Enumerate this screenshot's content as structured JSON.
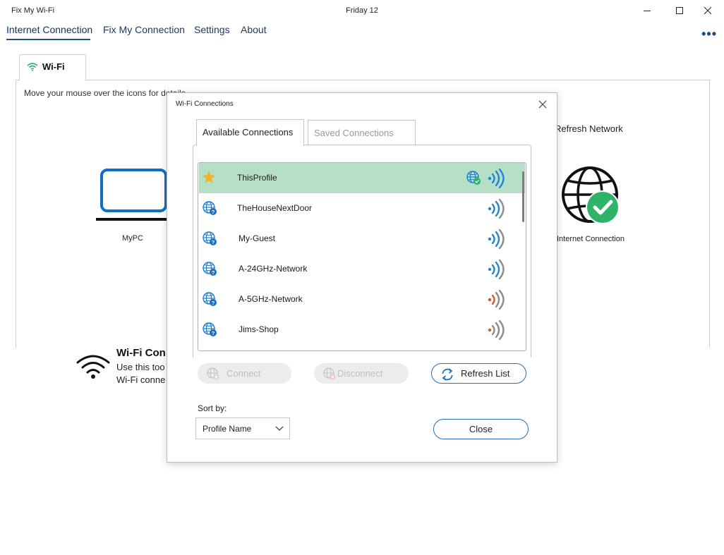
{
  "window": {
    "app_title": "Fix My Wi-Fi",
    "center_title": "Friday 12"
  },
  "nav": {
    "items": [
      "Internet Connection",
      "Fix My Connection",
      "Settings",
      "About"
    ],
    "active": "Internet Connection",
    "more": "•••"
  },
  "main": {
    "tab_label": "Wi-Fi",
    "hint": "Move your mouse over the icons for details",
    "mypc_label": "MyPC",
    "refresh_network_label": "Refresh Network",
    "internet_connection_label": "Internet Connection",
    "wifi_status_title": "Wi-Fi Con",
    "wifi_status_line1": "Use this too",
    "wifi_status_line2": "Wi-Fi conne"
  },
  "dialog": {
    "title": "Wi-Fi Connections",
    "tabs": [
      "Available Connections",
      "Saved Connections"
    ],
    "active_tab": "Available Connections",
    "networks": [
      {
        "name": "ThisProfile",
        "selected": true,
        "icon": "star-icon",
        "signal_color": "#1f86d6",
        "internet": true
      },
      {
        "name": "TheHouseNextDoor",
        "selected": false,
        "icon": "globe-question-icon",
        "signal_color": "#1f86d6",
        "internet": false
      },
      {
        "name": "My-Guest",
        "selected": false,
        "icon": "globe-question-icon",
        "signal_color": "#1f86d6",
        "internet": false
      },
      {
        "name": "A-24GHz-Network",
        "selected": false,
        "icon": "globe-question-icon",
        "signal_color": "#1f86d6",
        "internet": false
      },
      {
        "name": "A-5GHz-Network",
        "selected": false,
        "icon": "globe-question-icon",
        "signal_color": "#e0532a",
        "internet": false
      },
      {
        "name": "Jims-Shop",
        "selected": false,
        "icon": "globe-question-icon",
        "signal_color": "#e0532a",
        "internet": false
      }
    ],
    "buttons": {
      "connect": "Connect",
      "disconnect": "Disconnect",
      "refresh": "Refresh List",
      "close": "Close"
    },
    "sort_label": "Sort by:",
    "sort_value": "Profile Name"
  },
  "colors": {
    "accent": "#1c4f8f",
    "selected_row": "#b5e0c7",
    "laptop_blue": "#0f6fc6",
    "check_green": "#2fb36b"
  }
}
